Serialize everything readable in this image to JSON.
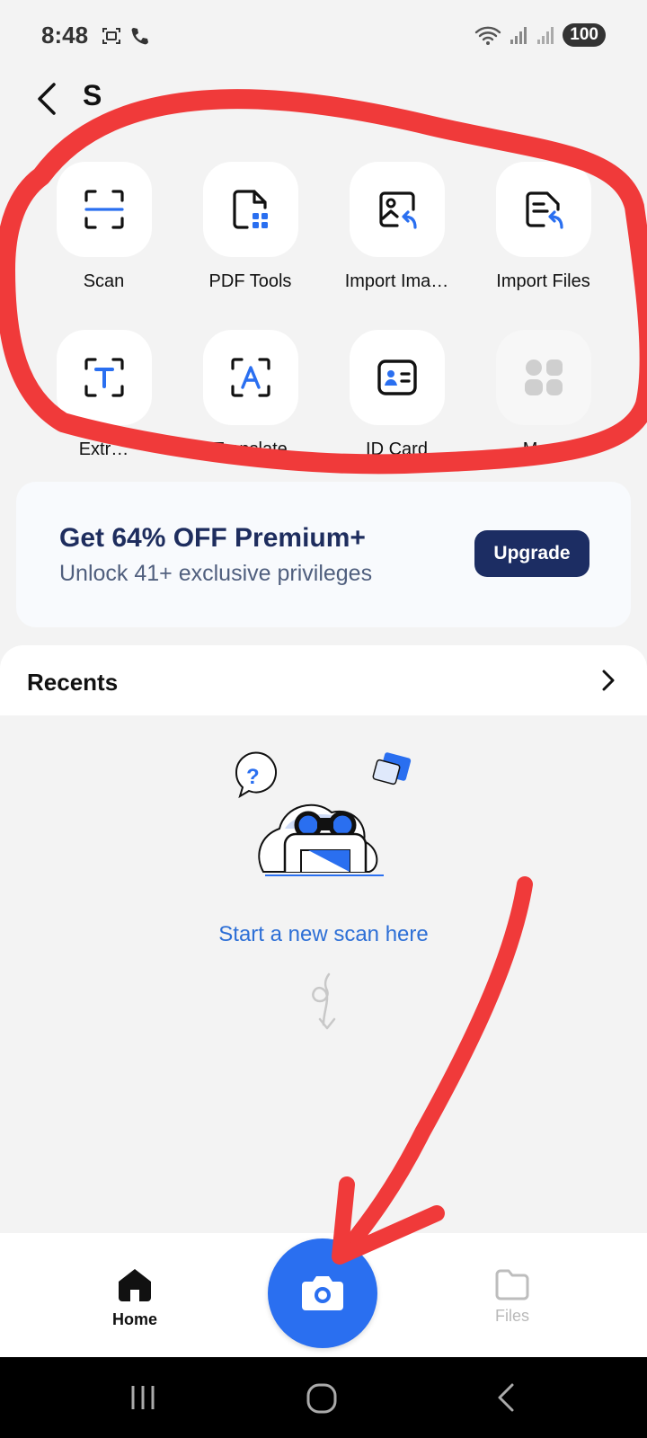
{
  "status_bar": {
    "time": "8:48",
    "battery": "100"
  },
  "header": {
    "title": "S"
  },
  "tools": [
    {
      "label": "Scan",
      "icon": "scan-frame-icon"
    },
    {
      "label": "PDF Tools",
      "icon": "pdf-tools-icon"
    },
    {
      "label": "Import Ima…",
      "icon": "import-image-icon"
    },
    {
      "label": "Import Files",
      "icon": "import-files-icon"
    },
    {
      "label": "Extr…",
      "icon": "extract-text-icon"
    },
    {
      "label": "Translate",
      "icon": "translate-icon"
    },
    {
      "label": "ID Card",
      "icon": "id-card-icon"
    },
    {
      "label": "More",
      "icon": "more-grid-icon"
    }
  ],
  "promo": {
    "title": "Get 64% OFF Premium+",
    "subtitle": "Unlock 41+ exclusive privileges",
    "button": "Upgrade"
  },
  "recents": {
    "title": "Recents",
    "empty_text": "Start a new scan here"
  },
  "bottom_nav": {
    "home": "Home",
    "files": "Files"
  },
  "colors": {
    "accent": "#2a6ff0",
    "navy": "#1c2d63",
    "annotation": "#f03a3a"
  }
}
